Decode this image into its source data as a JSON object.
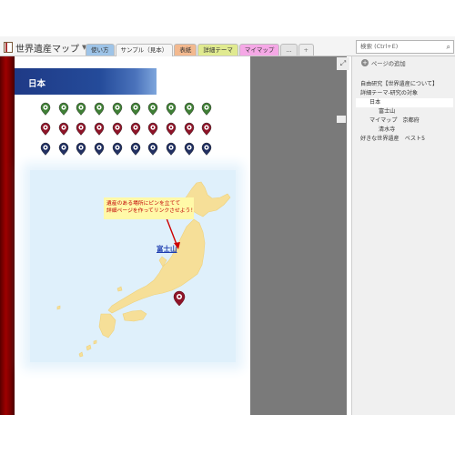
{
  "header": {
    "notebook_title": "世界遺産マップ",
    "tabs": [
      {
        "label": "使い方",
        "color": "#9ec4e8"
      },
      {
        "label": "サンプル（見本）",
        "color": "#f6f6f6"
      },
      {
        "label": "表紙",
        "color": "#f3b98f"
      },
      {
        "label": "詳細テーマ",
        "color": "#e0ea90"
      },
      {
        "label": "マイマップ",
        "color": "#f5a8e6"
      },
      {
        "label": "...",
        "color": "#e4e4e4"
      },
      {
        "label": "+",
        "color": "#ececec"
      }
    ],
    "search_placeholder": "検索 (Ctrl+E)"
  },
  "page": {
    "title": "日本",
    "callout_lines": [
      "遺産のある場所にピンを立てて",
      "詳細ページを作ってリンクさせよう！"
    ],
    "map_link": "富士山",
    "pin_rows": [
      {
        "color": "#3f7f35",
        "count": 10
      },
      {
        "color": "#8e1428",
        "count": 10
      },
      {
        "color": "#1e2d5f",
        "count": 10
      }
    ],
    "map_pin_color": "#8e1428",
    "land_color": "#f6df98",
    "arrow_color": "#cc0000"
  },
  "sidebar": {
    "add_page": "ページの追加",
    "pages": [
      {
        "label": "自由研究【世界遺産について】",
        "indent": 0,
        "selected": false
      },
      {
        "label": "詳細テーマ-研究の対象",
        "indent": 0,
        "selected": false
      },
      {
        "label": "日本",
        "indent": 1,
        "selected": true
      },
      {
        "label": "富士山",
        "indent": 2,
        "selected": false
      },
      {
        "label": "マイマップ　京都府",
        "indent": 1,
        "selected": false
      },
      {
        "label": "清水寺",
        "indent": 2,
        "selected": false
      },
      {
        "label": "好きな世界遺産　ベスト5",
        "indent": 0,
        "selected": false
      }
    ]
  }
}
